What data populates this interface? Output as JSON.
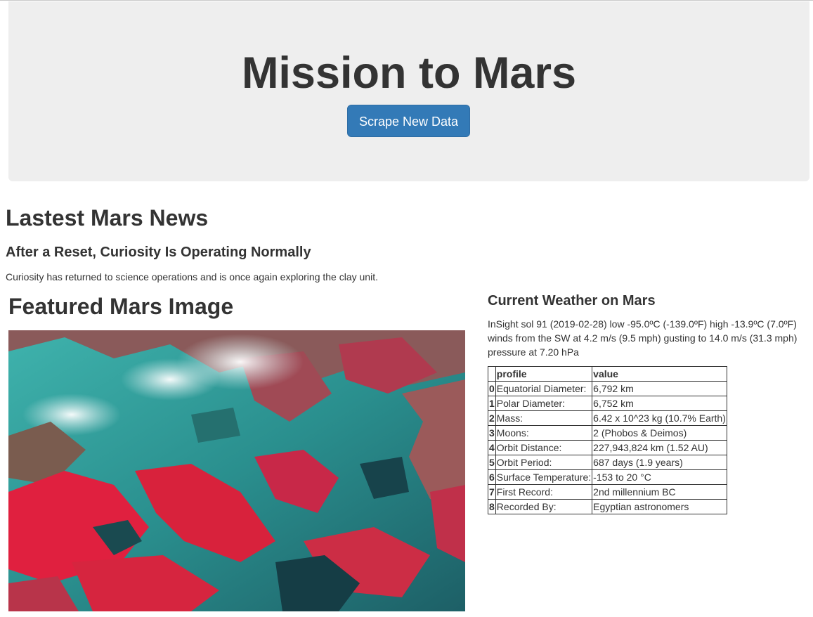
{
  "header": {
    "title": "Mission to Mars",
    "button_label": "Scrape New Data"
  },
  "news": {
    "heading": "Lastest Mars News",
    "title": "After a Reset, Curiosity Is Operating Normally",
    "paragraph": "Curiosity has returned to science operations and is once again exploring the clay unit."
  },
  "featured_image": {
    "heading": "Featured Mars Image"
  },
  "weather": {
    "heading": "Current Weather on Mars",
    "text": "InSight sol 91 (2019-02-28) low -95.0ºC (-139.0ºF) high -13.9ºC (7.0ºF) winds from the SW at 4.2 m/s (9.5 mph) gusting to 14.0 m/s (31.3 mph) pressure at 7.20 hPa"
  },
  "facts": {
    "columns": [
      "",
      "profile",
      "value"
    ],
    "rows": [
      {
        "index": "0",
        "profile": "Equatorial Diameter:",
        "value": "6,792 km"
      },
      {
        "index": "1",
        "profile": "Polar Diameter:",
        "value": "6,752 km"
      },
      {
        "index": "2",
        "profile": "Mass:",
        "value": "6.42 x 10^23 kg (10.7% Earth)"
      },
      {
        "index": "3",
        "profile": "Moons:",
        "value": "2 (Phobos & Deimos)"
      },
      {
        "index": "4",
        "profile": "Orbit Distance:",
        "value": "227,943,824 km (1.52 AU)"
      },
      {
        "index": "5",
        "profile": "Orbit Period:",
        "value": "687 days (1.9 years)"
      },
      {
        "index": "6",
        "profile": "Surface Temperature:",
        "value": "-153 to 20 °C"
      },
      {
        "index": "7",
        "profile": "First Record:",
        "value": "2nd millennium BC"
      },
      {
        "index": "8",
        "profile": "Recorded By:",
        "value": "Egyptian astronomers"
      }
    ]
  },
  "colors": {
    "jumbotron_bg": "#eeeeee",
    "button_bg": "#337ab7",
    "text": "#333333"
  }
}
